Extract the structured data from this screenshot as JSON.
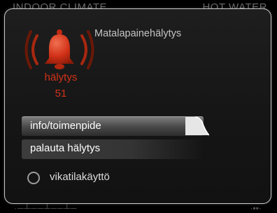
{
  "background": {
    "header_left": "INDOOR CLIMATE",
    "header_right": "HOT WATER"
  },
  "alarm": {
    "icon": "bell-icon",
    "label": "hälytys",
    "number": "51",
    "title": "Matalapainehälytys"
  },
  "menu": {
    "items": [
      {
        "label": "info/toimenpide"
      },
      {
        "label": "palauta hälytys"
      }
    ],
    "radio": {
      "label": "vikatilakäyttö",
      "checked": false
    }
  },
  "colors": {
    "alarm_red": "#d23218",
    "dialog_border": "#c8c8c8",
    "selected_item": "#7d7d7d"
  }
}
